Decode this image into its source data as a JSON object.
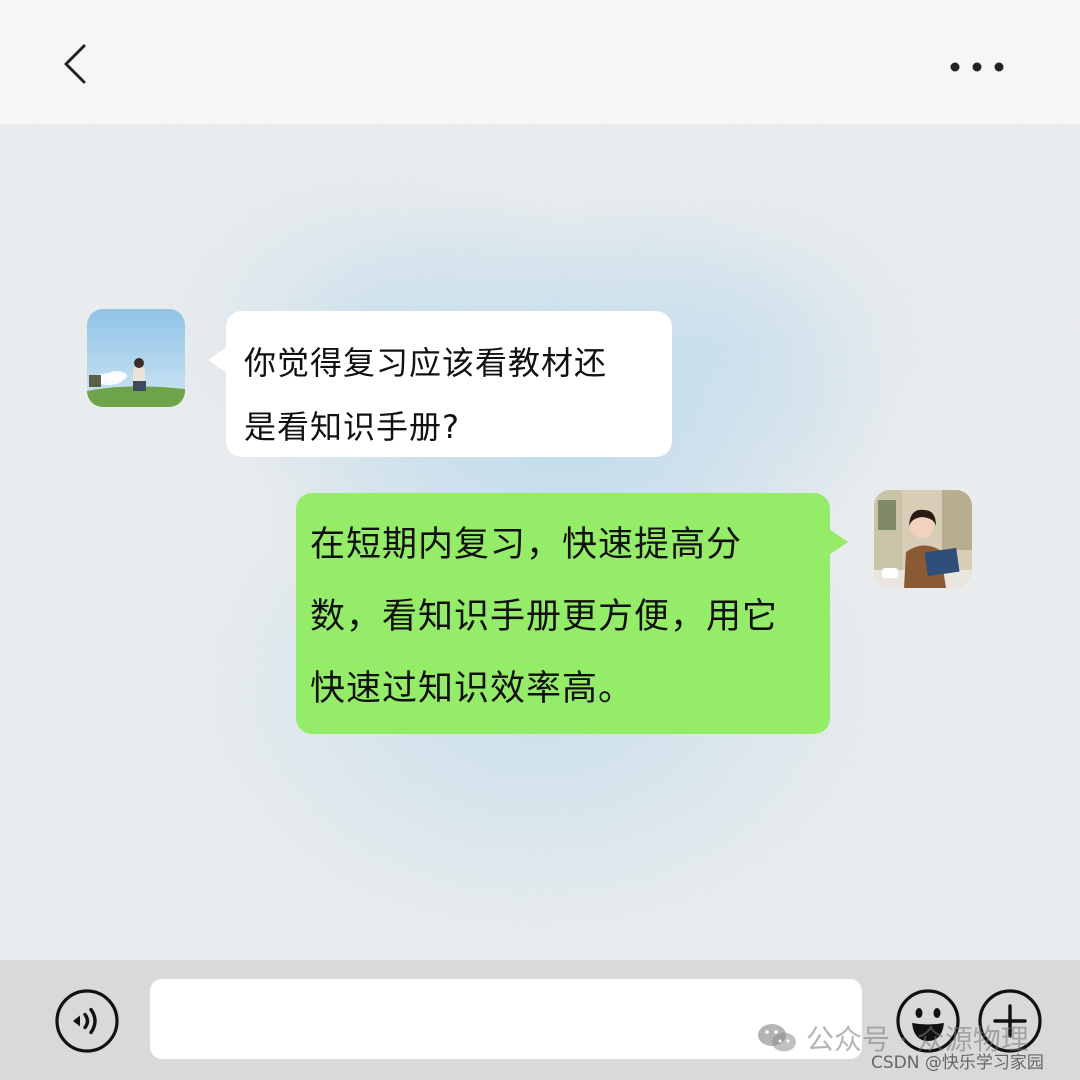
{
  "header": {
    "back_icon": "chevron-left-icon",
    "more_icon": "more-dots-icon"
  },
  "messages": [
    {
      "side": "left",
      "avatar": "avatar-girl-sitting-on-grass",
      "lines": [
        "你觉得复习应该看教材还",
        "是看知识手册?"
      ]
    },
    {
      "side": "right",
      "avatar": "avatar-girl-reading-book",
      "lines": [
        "在短期内复习，快速提高分",
        "数，看知识手册更方便，用它",
        "快速过知识效率高。"
      ]
    }
  ],
  "input_bar": {
    "voice_icon": "voice-icon",
    "input_value": "",
    "emoji_icon": "smiley-icon",
    "plus_icon": "plus-icon"
  },
  "watermark": {
    "line1": "公众号 · 众源物理",
    "line2": "CSDN @快乐学习家园"
  },
  "colors": {
    "header_bg": "#f6f6f6",
    "incoming_bubble": "#ffffff",
    "outgoing_bubble": "#95ec69",
    "bottom_bar_bg": "#d9d9d9"
  }
}
